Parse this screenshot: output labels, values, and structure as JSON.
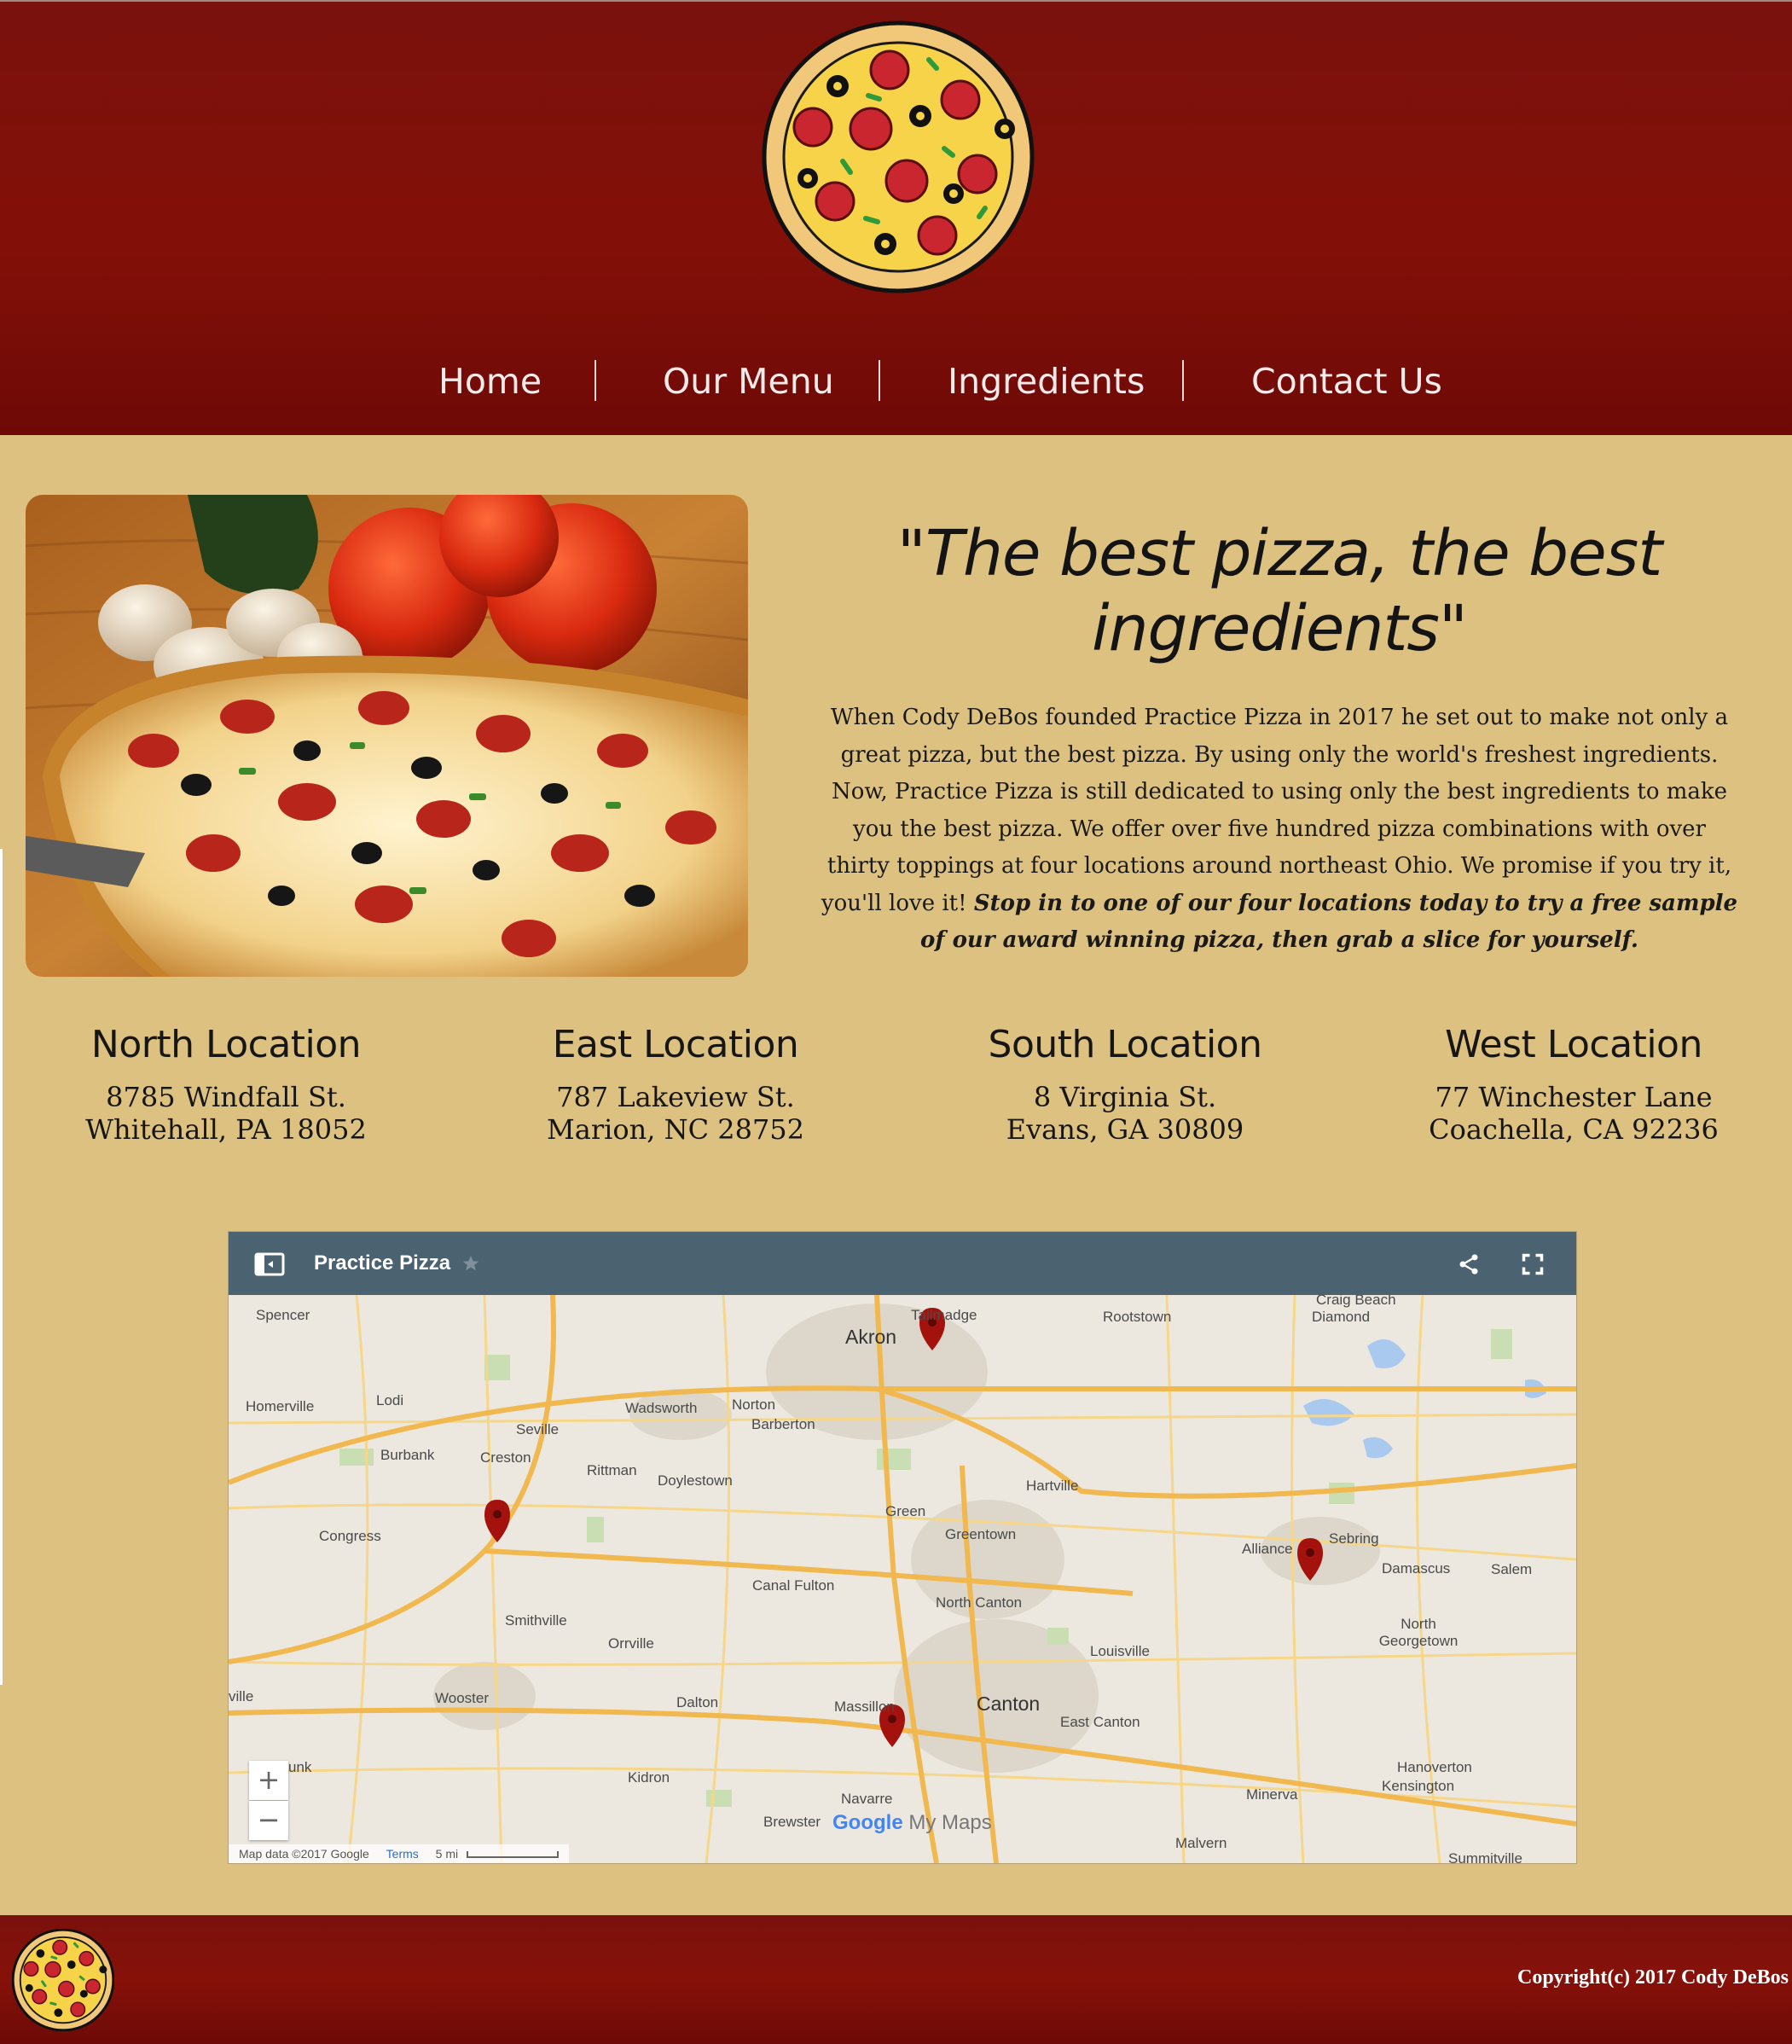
{
  "header": {
    "nav": [
      {
        "label": "Home"
      },
      {
        "label": "Our Menu"
      },
      {
        "label": "Ingredients"
      },
      {
        "label": "Contact Us"
      }
    ]
  },
  "hero": {
    "tagline_line1": "\"The best pizza, the best",
    "tagline_line2": "ingredients\"",
    "intro": "When Cody DeBos founded Practice Pizza in 2017 he set out to make not only a great pizza, but the best pizza. By using only the world's freshest ingredients. Now, Practice Pizza is still dedicated to using only the best ingredients to make you the best pizza. We offer over five hundred pizza combinations with over thirty toppings at four locations around northeast Ohio. We promise if you try it, you'll love it!",
    "intro_emphasis": "Stop in to one of our four locations today to try a free sample of our award winning pizza, then grab a slice for yourself."
  },
  "locations": [
    {
      "title": "North Location",
      "street": "8785 Windfall St.",
      "city": "Whitehall, PA 18052"
    },
    {
      "title": "East Location",
      "street": "787 Lakeview St.",
      "city": "Marion, NC 28752"
    },
    {
      "title": "South Location",
      "street": "8 Virginia St.",
      "city": "Evans, GA 30809"
    },
    {
      "title": "West Location",
      "street": "77 Winchester Lane",
      "city": "Coachella, CA 92236"
    }
  ],
  "map": {
    "title": "Practice Pizza",
    "zoom_in": "+",
    "zoom_out": "−",
    "attribution": "Map data ©2017 Google",
    "terms": "Terms",
    "scale": "5 mi",
    "brand_google": "Google",
    "brand_mymaps": "My Maps",
    "places": {
      "akron": "Akron",
      "tallmadge": "Tallmadge",
      "rootstown": "Rootstown",
      "diamond": "Diamond",
      "craig_beach": "Craig Beach",
      "spencer": "Spencer",
      "homerville": "Homerville",
      "lodi": "Lodi",
      "seville": "Seville",
      "wadsworth": "Wadsworth",
      "norton": "Norton",
      "barberton": "Barberton",
      "burbank": "Burbank",
      "creston": "Creston",
      "rittman": "Rittman",
      "doylestown": "Doylestown",
      "hartville": "Hartville",
      "green": "Green",
      "greentown": "Greentown",
      "congress": "Congress",
      "alliance": "Alliance",
      "sebring": "Sebring",
      "damascus": "Damascus",
      "salem": "Salem",
      "canal_fulton": "Canal Fulton",
      "north_canton": "North Canton",
      "smithville": "Smithville",
      "orrville": "Orrville",
      "louisville": "Louisville",
      "north_georgetown": "North Georgetown",
      "wooster": "Wooster",
      "dalton": "Dalton",
      "massillon": "Massillon",
      "canton": "Canton",
      "east_canton": "East Canton",
      "kidron": "Kidron",
      "navarre": "Navarre",
      "brewster": "Brewster",
      "minerva": "Minerva",
      "hanoverton": "Hanoverton",
      "kensington": "Kensington",
      "malvern": "Malvern",
      "summitville": "Summitville",
      "ville": "ville",
      "unk": "unk"
    }
  },
  "footer": {
    "copyright": "Copyright(c) 2017 Cody DeBos"
  },
  "colors": {
    "header_red": "#7a110d",
    "page_tan": "#ddc181",
    "map_bar": "#4b6270",
    "pin_red": "#a4120e"
  },
  "icons": [
    "pizza-logo",
    "map-panel-icon",
    "star-icon",
    "share-icon",
    "fullscreen-icon",
    "map-pin"
  ]
}
